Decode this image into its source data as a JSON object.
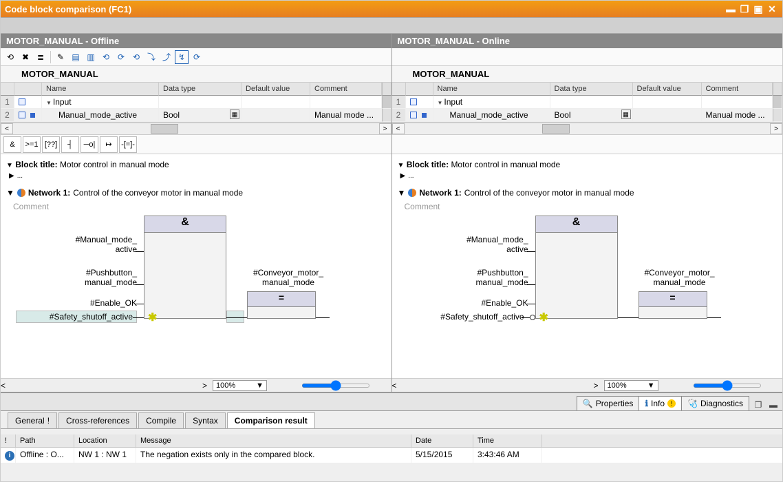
{
  "titlebar": {
    "title": "Code block comparison (FC1)"
  },
  "pane_left_title": "MOTOR_MANUAL - Offline",
  "pane_right_title": "MOTOR_MANUAL - Online",
  "block_name": "MOTOR_MANUAL",
  "param_headers": {
    "name": "Name",
    "type": "Data type",
    "default": "Default value",
    "comment": "Comment"
  },
  "param_rows": [
    {
      "idx": "1",
      "name": "Input",
      "type": "",
      "default": "",
      "comment": "",
      "group": true
    },
    {
      "idx": "2",
      "name": "Manual_mode_active",
      "type": "Bool",
      "default": "",
      "comment": "Manual mode ...",
      "group": false
    }
  ],
  "logic_toolbar": [
    "&",
    ">=1",
    "[??]",
    "┤",
    "─o|",
    "↦",
    "-[=]-"
  ],
  "block_title_label": "Block title:",
  "block_title_text": "Motor control in manual mode",
  "network_label": "Network 1:",
  "network_text": "Control of the conveyor motor in manual mode",
  "comment_placeholder": "Comment",
  "signals": {
    "manual_mode": "#Manual_mode_\nactive",
    "pushbutton": "#Pushbutton_\nmanual_mode",
    "enable": "#Enable_OK",
    "safety": "#Safety_shutoff_active",
    "conveyor": "#Conveyor_motor_\nmanual_mode"
  },
  "and_symbol": "&",
  "eq_symbol": "=",
  "zoom": "100%",
  "inspect_tabs": {
    "properties": "Properties",
    "info": "Info",
    "diagnostics": "Diagnostics"
  },
  "sub_tabs": {
    "general": "General",
    "xref": "Cross-references",
    "compile": "Compile",
    "syntax": "Syntax",
    "result": "Comparison result"
  },
  "result_headers": {
    "path": "Path",
    "location": "Location",
    "message": "Message",
    "date": "Date",
    "time": "Time"
  },
  "result_row": {
    "path": "Offline : O...",
    "location": "NW 1 : NW 1",
    "message": "The negation exists only in the compared block.",
    "date": "5/15/2015",
    "time": "3:43:46 AM"
  }
}
